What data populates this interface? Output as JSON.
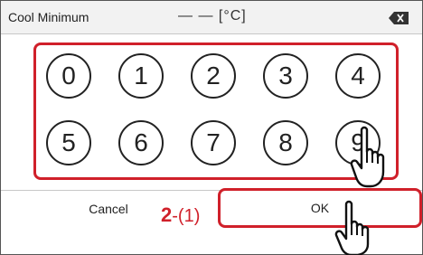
{
  "header": {
    "title": "Cool Minimum",
    "value": "— — [°C]",
    "backspace_icon": "backspace-icon"
  },
  "keypad": {
    "keys": [
      "0",
      "1",
      "2",
      "3",
      "4",
      "5",
      "6",
      "7",
      "8",
      "9"
    ],
    "highlight_color": "#d0202a"
  },
  "footer": {
    "cancel_label": "Cancel",
    "ok_label": "OK"
  },
  "annotation": {
    "step_bold": "2",
    "step_rest": "-(1)",
    "pointer_icon": "hand-pointer-icon"
  }
}
